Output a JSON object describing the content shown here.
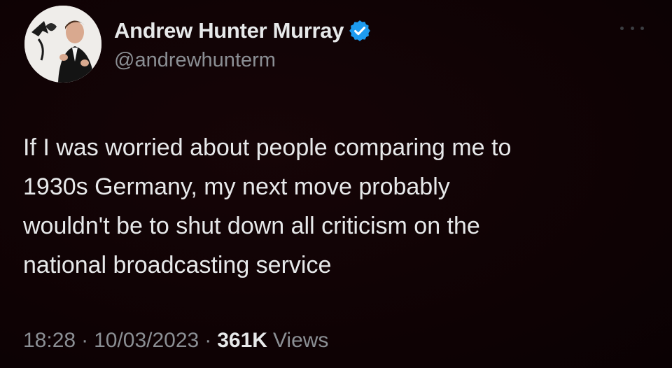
{
  "author": {
    "display_name": "Andrew Hunter Murray",
    "handle": "@andrewhunterm",
    "verified": true
  },
  "tweet": {
    "text_lines": [
      "If I was worried about people comparing me to",
      "1930s Germany, my next move probably",
      "wouldn't be to shut down all criticism on the",
      "national broadcasting service"
    ],
    "time": "18:28",
    "date": "10/03/2023",
    "separator": "·",
    "views_count": "361K",
    "views_label": "Views"
  },
  "icons": {
    "verified": "verified-badge-icon",
    "more": "more-options-icon"
  },
  "colors": {
    "background": "#0f0305",
    "text": "#e7e9ea",
    "secondary": "#8b8f94",
    "verified": "#1d9bf0"
  }
}
